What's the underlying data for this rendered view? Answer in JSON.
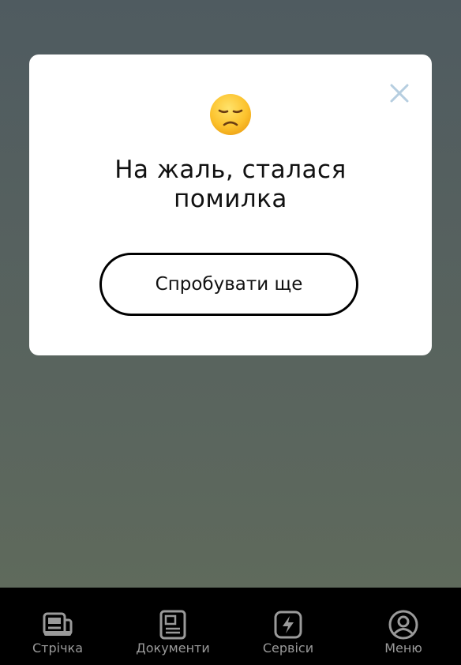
{
  "dialog": {
    "title_line1": "На жаль, сталася",
    "title_line2": "помилка",
    "retry_label": "Спробувати ще",
    "emoji_icon": "disappointed-face-icon",
    "close_icon": "close-icon"
  },
  "tabs": [
    {
      "label": "Стрічка",
      "icon": "feed-icon"
    },
    {
      "label": "Документи",
      "icon": "documents-icon"
    },
    {
      "label": "Сервіси",
      "icon": "services-icon"
    },
    {
      "label": "Меню",
      "icon": "profile-icon"
    }
  ],
  "colors": {
    "backdrop": "#55605f",
    "tabbar_bg": "#000000",
    "tab_inactive": "#9a9a9a",
    "close_icon": "#b6cee0"
  }
}
